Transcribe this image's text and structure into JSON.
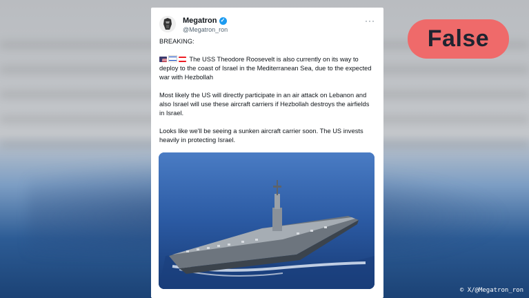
{
  "post": {
    "author_name": "Megatron",
    "author_handle": "@Megatron_ron",
    "more_glyph": "···",
    "paragraphs": [
      "BREAKING:",
      "The USS Theodore Roosevelt is also currently on its way to deploy to the coast of Israel in the Mediterranean Sea, due to the expected war with Hezbollah",
      "Most likely the US will directly participate in an air attack on Lebanon and also Israel will use these aircraft carriers if Hezbollah destroys the airfields in Israel.",
      "Looks like we'll be seeing a sunken aircraft carrier soon. The US invests heavily in protecting Israel."
    ],
    "flags": [
      "us-flag-icon",
      "israel-flag-icon",
      "lebanon-flag-icon"
    ]
  },
  "verdict": {
    "label": "False",
    "color": "#ef6a6a"
  },
  "credit": {
    "text": "© X/@Megatron_ron"
  }
}
